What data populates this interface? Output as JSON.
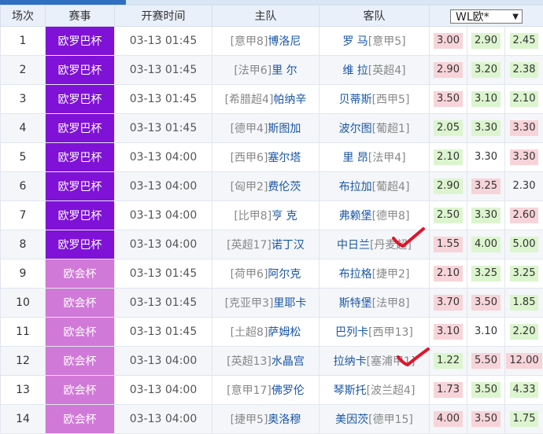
{
  "header": {
    "col_index": "场次",
    "col_league": "赛事",
    "col_time": "开赛时间",
    "col_home": "主队",
    "col_away": "客队",
    "odds_select": "WL欧*"
  },
  "colors": {
    "europa_league": "#7f12d6",
    "conference_league": "#d179d8",
    "odds_high": "#f7d4d9",
    "odds_low": "#dcf5cf",
    "team_text": "#1a56a6",
    "check_mark": "#e0142a"
  },
  "rows": [
    {
      "idx": "1",
      "league": "欧罗巴杯",
      "lt": "el",
      "time": "03-13 01:45",
      "home_rank": "[意甲8]",
      "home": "博洛尼",
      "away": "罗 马",
      "away_rank": "[意甲5]",
      "o1": "3.00",
      "o2": "2.90",
      "o3": "2.45",
      "c1": "pink",
      "c2": "green",
      "c3": "green"
    },
    {
      "idx": "2",
      "league": "欧罗巴杯",
      "lt": "el",
      "time": "03-13 01:45",
      "home_rank": "[法甲6]",
      "home": "里 尔",
      "away": "维 拉",
      "away_rank": "[英超4]",
      "o1": "2.90",
      "o2": "3.20",
      "o3": "2.38",
      "c1": "pink",
      "c2": "green",
      "c3": "green"
    },
    {
      "idx": "3",
      "league": "欧罗巴杯",
      "lt": "el",
      "time": "03-13 01:45",
      "home_rank": "[希腊超4]",
      "home": "帕纳辛",
      "away": "贝蒂斯",
      "away_rank": "[西甲5]",
      "o1": "3.50",
      "o2": "3.10",
      "o3": "2.10",
      "c1": "pink",
      "c2": "green",
      "c3": "green"
    },
    {
      "idx": "4",
      "league": "欧罗巴杯",
      "lt": "el",
      "time": "03-13 01:45",
      "home_rank": "[德甲4]",
      "home": "斯图加",
      "away": "波尔图",
      "away_rank": "[葡超1]",
      "o1": "2.05",
      "o2": "3.30",
      "o3": "3.30",
      "c1": "green",
      "c2": "green",
      "c3": "pink"
    },
    {
      "idx": "5",
      "league": "欧罗巴杯",
      "lt": "el",
      "time": "03-13 04:00",
      "home_rank": "[西甲6]",
      "home": "塞尔塔",
      "away": "里 昂",
      "away_rank": "[法甲4]",
      "o1": "2.10",
      "o2": "3.30",
      "o3": "3.30",
      "c1": "green",
      "c2": "none",
      "c3": "pink"
    },
    {
      "idx": "6",
      "league": "欧罗巴杯",
      "lt": "el",
      "time": "03-13 04:00",
      "home_rank": "[匈甲2]",
      "home": "费伦茨",
      "away": "布拉加",
      "away_rank": "[葡超4]",
      "o1": "2.90",
      "o2": "3.25",
      "o3": "2.30",
      "c1": "green",
      "c2": "pink",
      "c3": "none"
    },
    {
      "idx": "7",
      "league": "欧罗巴杯",
      "lt": "el",
      "time": "03-13 04:00",
      "home_rank": "[比甲8]",
      "home": "亨 克",
      "away": "弗赖堡",
      "away_rank": "[德甲8]",
      "o1": "2.50",
      "o2": "3.30",
      "o3": "2.60",
      "c1": "green",
      "c2": "green",
      "c3": "pink"
    },
    {
      "idx": "8",
      "league": "欧罗巴杯",
      "lt": "el",
      "time": "03-13 04:00",
      "home_rank": "[英超17]",
      "home": "诺丁汉",
      "away": "中日兰",
      "away_rank": "[丹麦超]",
      "o1": "1.55",
      "o2": "4.00",
      "o3": "5.00",
      "c1": "pink",
      "c2": "green",
      "c3": "green"
    },
    {
      "idx": "9",
      "league": "欧会杯",
      "lt": "ecl",
      "time": "03-13 01:45",
      "home_rank": "[荷甲6]",
      "home": "阿尔克",
      "away": "布拉格",
      "away_rank": "[捷甲2]",
      "o1": "2.10",
      "o2": "3.25",
      "o3": "3.25",
      "c1": "pink",
      "c2": "green",
      "c3": "green"
    },
    {
      "idx": "10",
      "league": "欧会杯",
      "lt": "ecl",
      "time": "03-13 01:45",
      "home_rank": "[克亚甲3]",
      "home": "里耶卡",
      "away": "斯特堡",
      "away_rank": "[法甲8]",
      "o1": "3.70",
      "o2": "3.50",
      "o3": "1.85",
      "c1": "pink",
      "c2": "pink",
      "c3": "green"
    },
    {
      "idx": "11",
      "league": "欧会杯",
      "lt": "ecl",
      "time": "03-13 01:45",
      "home_rank": "[土超8]",
      "home": "萨姆松",
      "away": "巴列卡",
      "away_rank": "[西甲13]",
      "o1": "3.10",
      "o2": "3.10",
      "o3": "2.20",
      "c1": "pink",
      "c2": "none",
      "c3": "green"
    },
    {
      "idx": "12",
      "league": "欧会杯",
      "lt": "ecl",
      "time": "03-13 04:00",
      "home_rank": "[英超13]",
      "home": "水晶宫",
      "away": "拉纳卡",
      "away_rank": "[塞浦甲1]",
      "o1": "1.22",
      "o2": "5.50",
      "o3": "12.00",
      "c1": "green",
      "c2": "pink",
      "c3": "pink"
    },
    {
      "idx": "13",
      "league": "欧会杯",
      "lt": "ecl",
      "time": "03-13 04:00",
      "home_rank": "[意甲17]",
      "home": "佛罗伦",
      "away": "琴斯托",
      "away_rank": "[波兰超4]",
      "o1": "1.73",
      "o2": "3.50",
      "o3": "4.33",
      "c1": "pink",
      "c2": "green",
      "c3": "green"
    },
    {
      "idx": "14",
      "league": "欧会杯",
      "lt": "ecl",
      "time": "03-13 04:00",
      "home_rank": "[捷甲5]",
      "home": "奥洛穆",
      "away": "美因茨",
      "away_rank": "[德甲15]",
      "o1": "4.00",
      "o2": "3.50",
      "o3": "1.75",
      "c1": "pink",
      "c2": "pink",
      "c3": "green"
    }
  ]
}
